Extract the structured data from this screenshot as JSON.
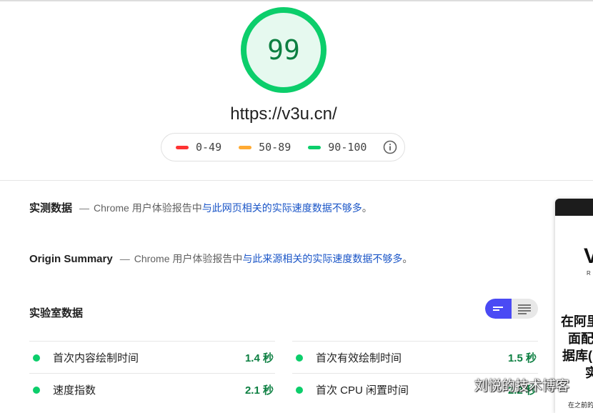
{
  "score": {
    "value": "99",
    "color": "#0cce6b"
  },
  "url": "https://v3u.cn/",
  "legend": {
    "items": [
      {
        "label": "0-49",
        "color": "#ff3333"
      },
      {
        "label": "50-89",
        "color": "#ffaa33"
      },
      {
        "label": "90-100",
        "color": "#0cce6b"
      }
    ],
    "info_icon": "info-icon"
  },
  "field_data": {
    "title": "实测数据",
    "dash": "—",
    "prefix": "Chrome 用户体验报告中",
    "link": "与此网页相关的实际速度数据不够多",
    "suffix": "。"
  },
  "origin_summary": {
    "title": "Origin Summary",
    "dash": "—",
    "prefix": "Chrome 用户体验报告中",
    "link": "与此来源相关的实际速度数据不够多",
    "suffix": "。"
  },
  "lab_data": {
    "title": "实验室数据",
    "toggle_icons": [
      "bar-view-icon",
      "list-view-icon"
    ],
    "metrics": [
      {
        "name": "首次内容绘制时间",
        "value": "1.4 秒"
      },
      {
        "name": "首次有效绘制时间",
        "value": "1.5 秒"
      },
      {
        "name": "速度指数",
        "value": "2.1 秒"
      },
      {
        "name": "首次 CPU 闲置时间",
        "value": "2.2 秒"
      }
    ]
  },
  "side_card": {
    "logo": "V",
    "sub": "R",
    "lines": [
      "在阿里",
      "面配",
      "据库(",
      "实"
    ],
    "small": "在之前的"
  },
  "watermark": {
    "text": "刘悦的技术博客",
    "icon": "wechat-icon"
  }
}
